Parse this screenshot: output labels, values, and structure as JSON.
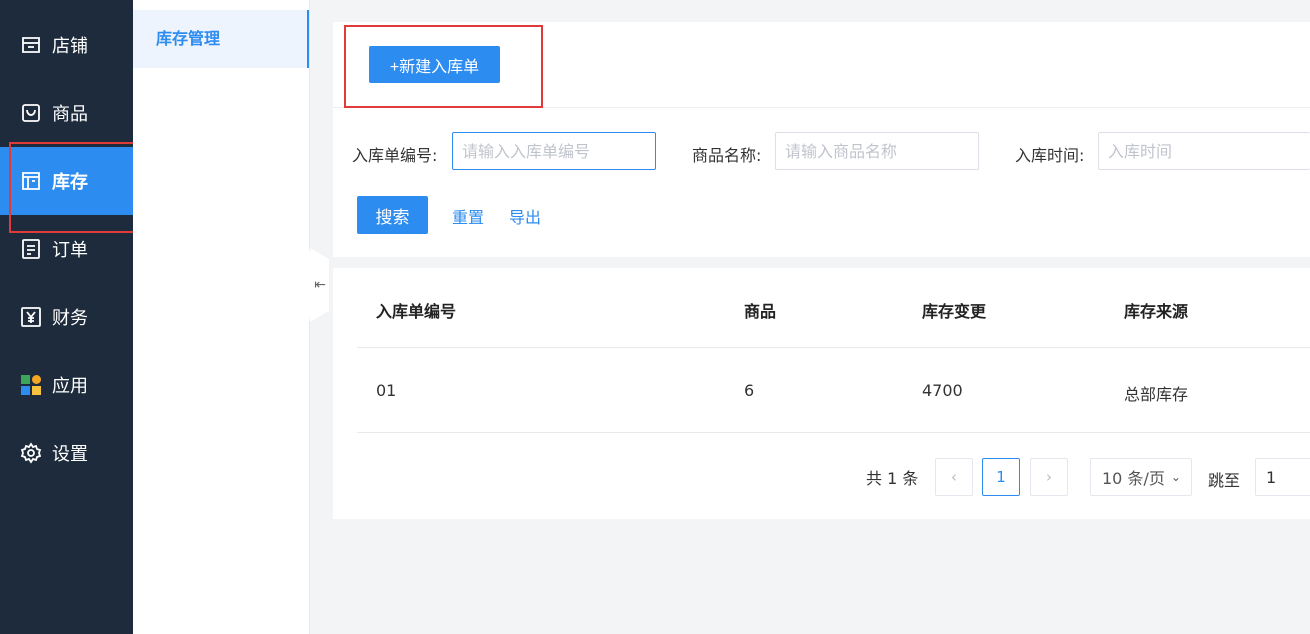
{
  "nav": {
    "items": [
      {
        "label": "店铺",
        "icon": "store-icon"
      },
      {
        "label": "商品",
        "icon": "bag-icon"
      },
      {
        "label": "库存",
        "icon": "warehouse-icon"
      },
      {
        "label": "订单",
        "icon": "document-icon"
      },
      {
        "label": "财务",
        "icon": "yen-icon"
      },
      {
        "label": "应用",
        "icon": "apps-grid-icon"
      },
      {
        "label": "设置",
        "icon": "gear-icon"
      }
    ],
    "active": "库存"
  },
  "subnav": {
    "items": [
      {
        "label": "库存管理"
      }
    ]
  },
  "toolbar": {
    "new_label": "+新建入库单"
  },
  "filters": {
    "order_no": {
      "label": "入库单编号:",
      "placeholder": "请输入入库单编号"
    },
    "product": {
      "label": "商品名称:",
      "placeholder": "请输入商品名称"
    },
    "time": {
      "label": "入库时间:",
      "placeholder": "入库时间"
    },
    "search_label": "搜索",
    "reset_label": "重置",
    "export_label": "导出"
  },
  "table": {
    "headers": [
      "入库单编号",
      "商品",
      "库存变更",
      "库存来源"
    ],
    "rows": [
      [
        "01",
        "6",
        "4700",
        "总部库存"
      ]
    ]
  },
  "pagination": {
    "total": "共 1 条",
    "current_page": "1",
    "prev_icon": "chevron-left-icon",
    "next_icon": "chevron-right-icon",
    "page_size": "10 条/页",
    "jump_label": "跳至",
    "jump_value": "1"
  },
  "colors": {
    "primary": "#2d8cf0",
    "nav_bg": "#1d2b3c",
    "highlight_box": "#e03a3a"
  }
}
